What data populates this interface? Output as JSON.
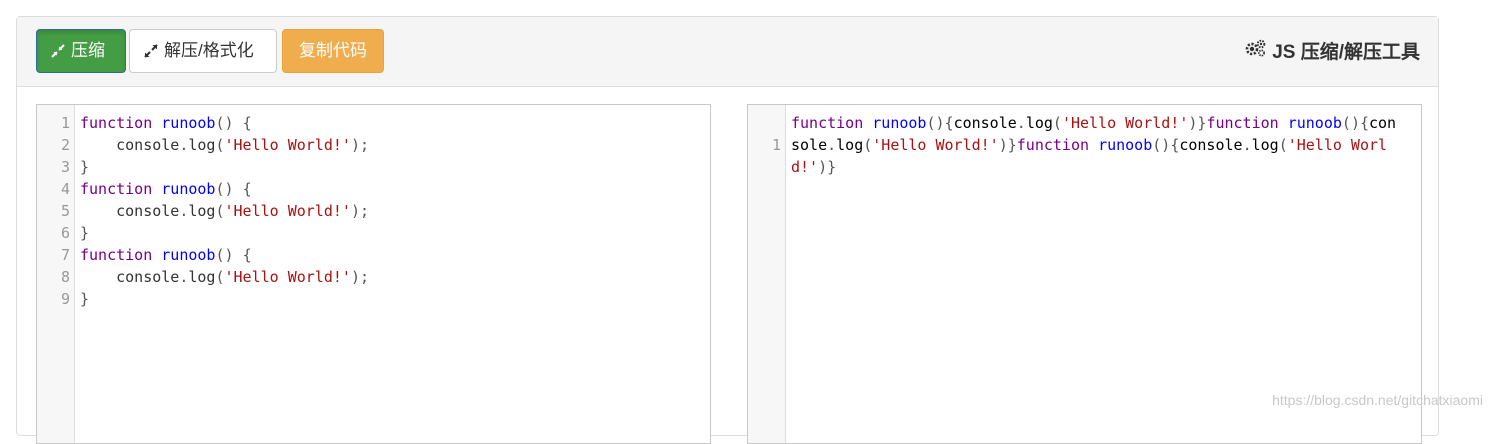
{
  "toolbar": {
    "compress_label": "压缩",
    "format_label": "解压/格式化",
    "copy_label": "复制代码",
    "compress_icon": "compress-icon",
    "format_icon": "expand-icon"
  },
  "header": {
    "title": "JS 压缩/解压工具",
    "title_icon": "gears-icon"
  },
  "input_editor": {
    "line_numbers": [
      "1",
      "2",
      "3",
      "4",
      "5",
      "6",
      "7",
      "8",
      "9"
    ],
    "lines": [
      "function runoob() {",
      "    console.log('Hello World!');",
      "}",
      "function runoob() {",
      "    console.log('Hello World!');",
      "}",
      "function runoob() {",
      "    console.log('Hello World!');",
      "}"
    ]
  },
  "output_editor": {
    "line_numbers": [
      "1"
    ],
    "content": "function runoob(){console.log('Hello World!')}function runoob(){console.log('Hello World!')}function runoob(){console.log('Hello World!')}"
  },
  "watermark": "https://blog.csdn.net/gitchatxiaomi",
  "colors": {
    "compress_button": "#449d44",
    "copy_button": "#f0ad4e",
    "keyword": "#770088",
    "function_name": "#0000ff",
    "string": "#aa1111"
  }
}
